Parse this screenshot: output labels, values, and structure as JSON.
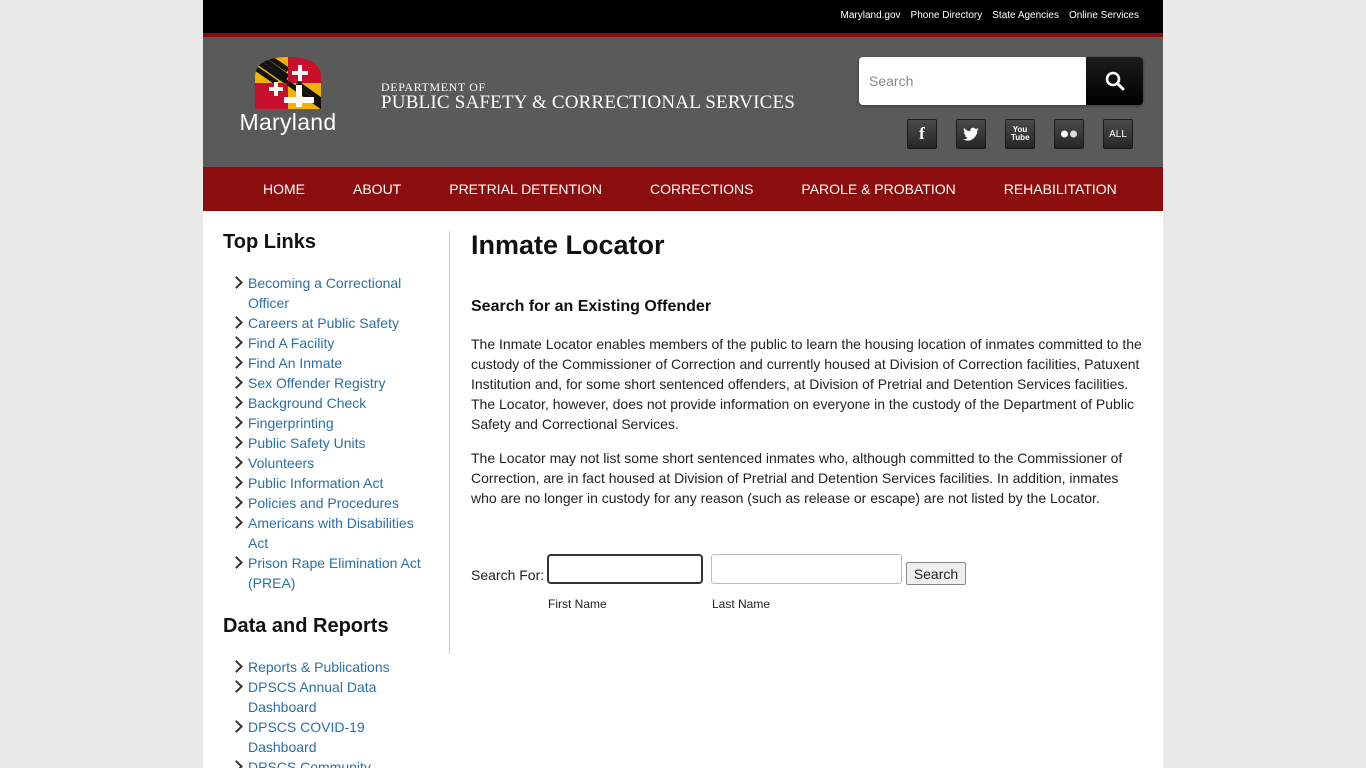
{
  "top_links": [
    "Maryland.gov",
    "Phone Directory",
    "State Agencies",
    "Online Services"
  ],
  "header": {
    "logo_text": "Maryland",
    "dept_line1": "DEPARTMENT OF",
    "dept_line2": "PUBLIC SAFETY & CORRECTIONAL SERVICES",
    "search_placeholder": "Search"
  },
  "social": [
    {
      "icon": "facebook-icon",
      "label": "f"
    },
    {
      "icon": "twitter-icon",
      "label": ""
    },
    {
      "icon": "youtube-icon",
      "label": "You Tube"
    },
    {
      "icon": "flickr-icon",
      "label": ""
    },
    {
      "icon": "all-icon",
      "label": "ALL"
    }
  ],
  "nav": [
    "HOME",
    "ABOUT",
    "PRETRIAL DETENTION",
    "CORRECTIONS",
    "PAROLE & PROBATION",
    "REHABILITATION"
  ],
  "sidebar": {
    "top_links_title": "Top Links",
    "top_links": [
      "Becoming a Correctional Officer",
      "Careers at Public Safety",
      "Find A Facility",
      "Find An Inmate",
      "Sex Offender Registry",
      "Background Check",
      "Fingerprinting",
      "Public Safety Units",
      "Volunteers",
      "Public Information Act",
      "Policies and Procedures",
      "Americans with Disabilities Act",
      "Prison Rape Elimination Act (PREA)"
    ],
    "data_title": "Data and Reports",
    "data_links": [
      "Reports & Publications",
      "DPSCS Annual Data Dashboard",
      "DPSCS COVID-19 Dashboard",
      "DPSCS Community"
    ]
  },
  "main": {
    "title": "Inmate Locator",
    "subtitle": "Search for an Existing Offender",
    "para1": "The Inmate Locator enables members of the public to learn the housing location of inmates committed to the custody of the Commissioner of Correction and currently housed at Division of Correction facilities, Patuxent Institution and, for some short sentenced offenders, at Division of Pretrial and Detention Services facilities. The Locator, however, does not provide information on everyone in the custody of the Department of Public Safety and Correctional Services.",
    "para2": "The Locator may not list some short sentenced inmates who, although committed to the Commissioner of Correction, are in fact housed at Division of Pretrial and Detention Services facilities. In addition, inmates who are no longer in custody for any reason (such as release or escape) are not listed by the Locator."
  },
  "form": {
    "label": "Search For:",
    "first_name_value": "",
    "last_name_value": "",
    "first_name_label": "First Name",
    "last_name_label": "Last Name",
    "button": "Search"
  },
  "colors": {
    "nav_bg": "#8c0d0d",
    "header_bg": "#5a5a5a",
    "link": "#2a6fa8"
  }
}
